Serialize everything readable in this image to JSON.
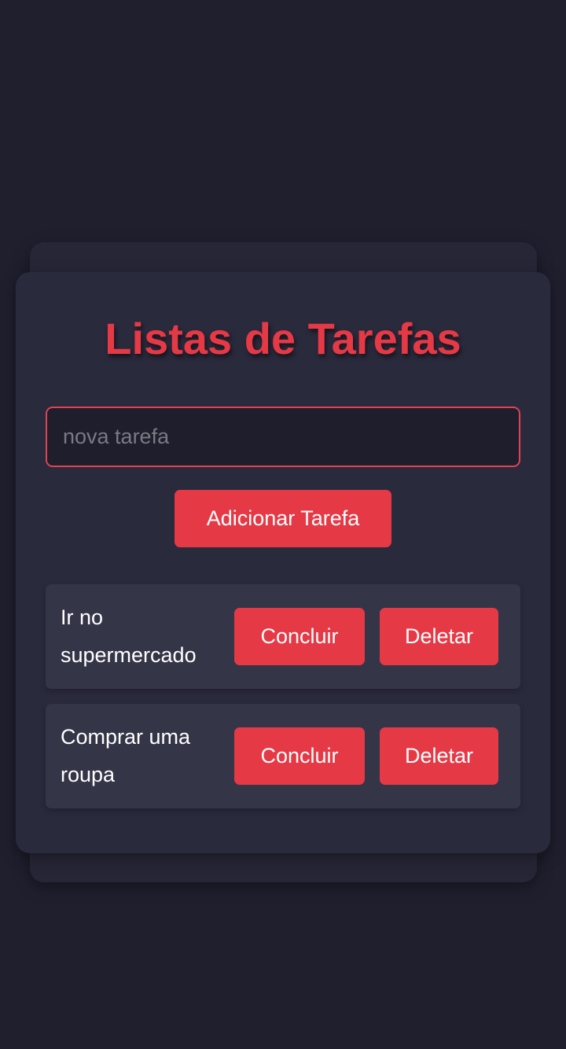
{
  "header": {
    "title": "Listas de Tarefas"
  },
  "input": {
    "placeholder": "nova tarefa",
    "value": ""
  },
  "add_button": {
    "label": "Adicionar Tarefa"
  },
  "tasks": [
    {
      "text": "Ir no supermercado",
      "complete_label": "Concluir",
      "delete_label": "Deletar"
    },
    {
      "text": "Comprar uma roupa",
      "complete_label": "Concluir",
      "delete_label": "Deletar"
    }
  ],
  "colors": {
    "background": "#1f1f2e",
    "card": "#2a2a3d",
    "item": "#353548",
    "accent": "#e63946"
  }
}
